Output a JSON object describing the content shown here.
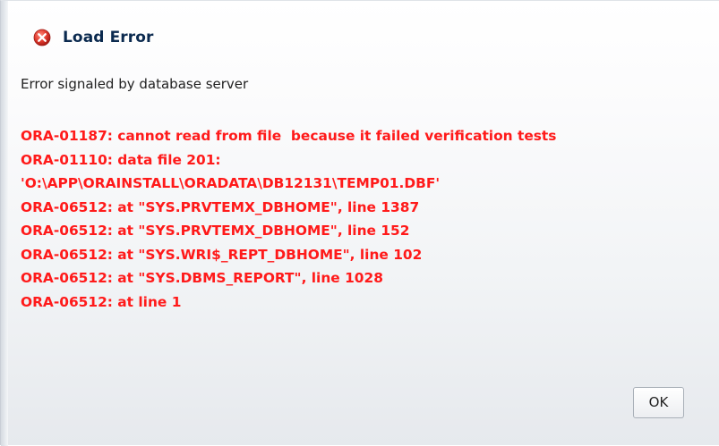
{
  "dialog": {
    "title": "Load Error",
    "title_icon": "error-x-circle-icon",
    "subtitle": "Error signaled by database server",
    "error_lines": [
      "ORA-01187: cannot read from file  because it failed verification tests",
      "ORA-01110: data file 201:",
      "'O:\\APP\\ORAINSTALL\\ORADATA\\DB12131\\TEMP01.DBF'",
      "ORA-06512: at \"SYS.PRVTEMX_DBHOME\", line 1387",
      "ORA-06512: at \"SYS.PRVTEMX_DBHOME\", line 152",
      "ORA-06512: at \"SYS.WRI$_REPT_DBHOME\", line 102",
      "ORA-06512: at \"SYS.DBMS_REPORT\", line 1028",
      "ORA-06512: at line 1"
    ],
    "ok_label": "OK"
  },
  "colors": {
    "error_text": "#ff1a1a",
    "title_text": "#0b2a4f",
    "icon_red": "#d42a2a"
  }
}
